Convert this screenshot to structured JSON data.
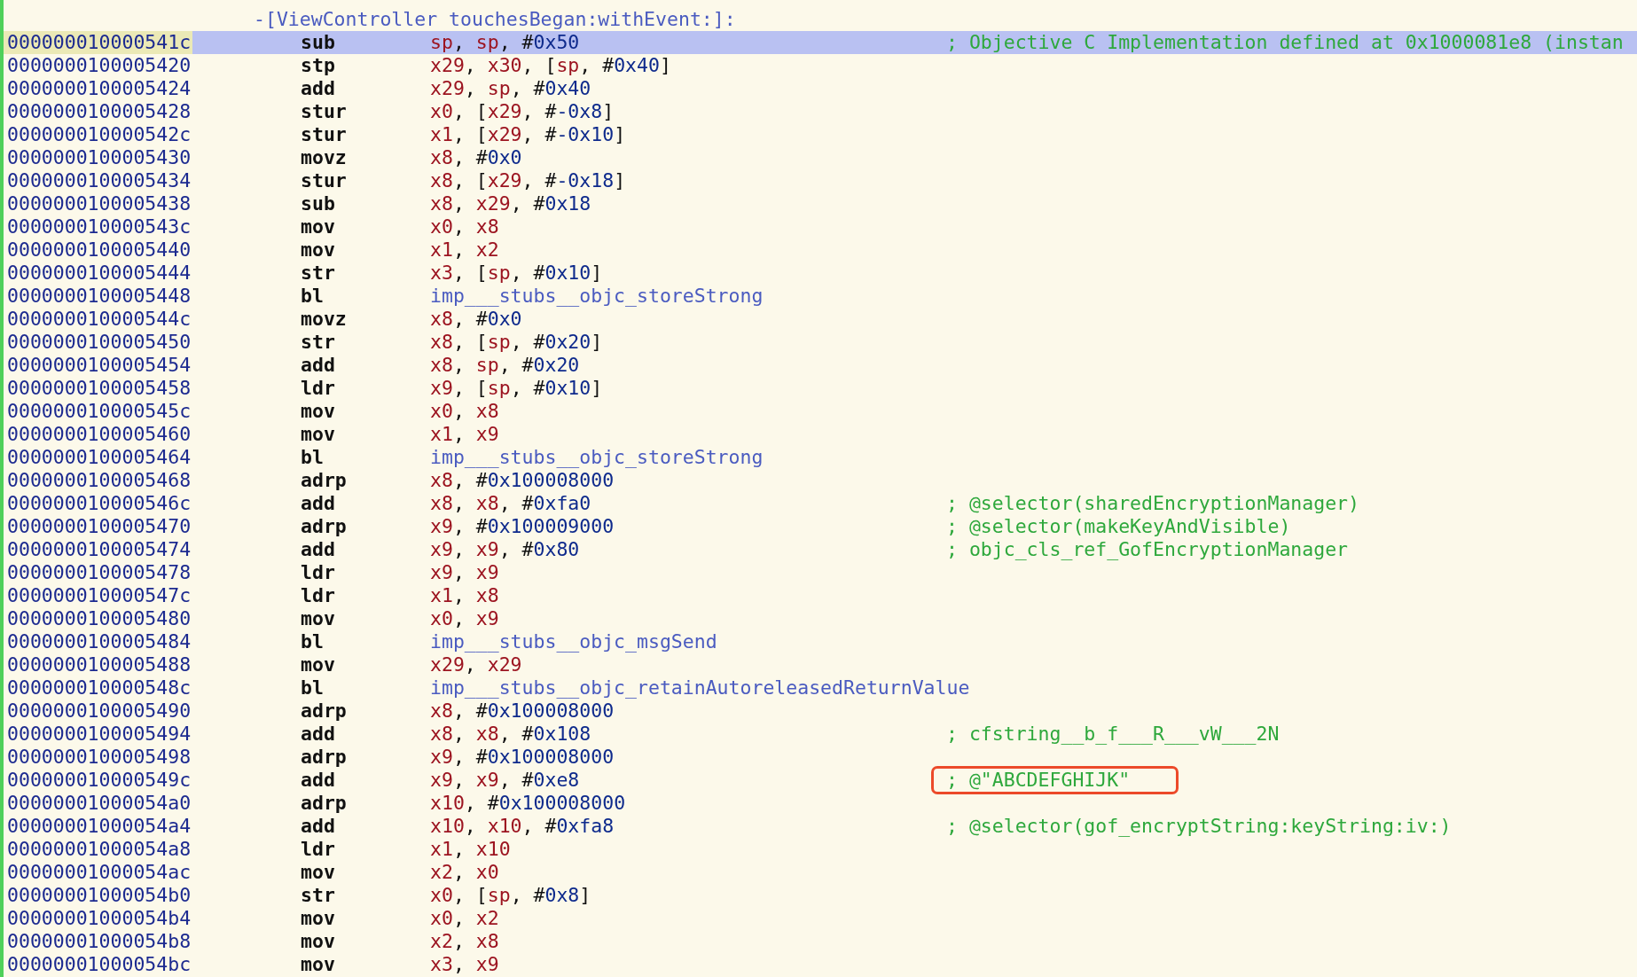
{
  "procedure_header": "-[ViewController touchesBegan:withEvent:]:",
  "rows": [
    {
      "address": "000000010000541c",
      "mnemonic": "sub",
      "operands": [
        {
          "kind": "reg",
          "text": "sp"
        },
        {
          "kind": "punct",
          "text": ", "
        },
        {
          "kind": "reg",
          "text": "sp"
        },
        {
          "kind": "punct",
          "text": ", #"
        },
        {
          "kind": "imm",
          "text": "0x50"
        }
      ],
      "comment": {
        "text": "; Objective C Implementation defined at 0x1000081e8 (instan",
        "boxed": false
      },
      "selected": true
    },
    {
      "address": "0000000100005420",
      "mnemonic": "stp",
      "operands": [
        {
          "kind": "reg",
          "text": "x29"
        },
        {
          "kind": "punct",
          "text": ", "
        },
        {
          "kind": "reg",
          "text": "x30"
        },
        {
          "kind": "punct",
          "text": ", ["
        },
        {
          "kind": "reg",
          "text": "sp"
        },
        {
          "kind": "punct",
          "text": ", #"
        },
        {
          "kind": "imm",
          "text": "0x40"
        },
        {
          "kind": "punct",
          "text": "]"
        }
      ],
      "selected": false
    },
    {
      "address": "0000000100005424",
      "mnemonic": "add",
      "operands": [
        {
          "kind": "reg",
          "text": "x29"
        },
        {
          "kind": "punct",
          "text": ", "
        },
        {
          "kind": "reg",
          "text": "sp"
        },
        {
          "kind": "punct",
          "text": ", #"
        },
        {
          "kind": "imm",
          "text": "0x40"
        }
      ],
      "selected": false
    },
    {
      "address": "0000000100005428",
      "mnemonic": "stur",
      "operands": [
        {
          "kind": "reg",
          "text": "x0"
        },
        {
          "kind": "punct",
          "text": ", ["
        },
        {
          "kind": "reg",
          "text": "x29"
        },
        {
          "kind": "punct",
          "text": ", #"
        },
        {
          "kind": "imm",
          "text": "-0x8"
        },
        {
          "kind": "punct",
          "text": "]"
        }
      ],
      "selected": false
    },
    {
      "address": "000000010000542c",
      "mnemonic": "stur",
      "operands": [
        {
          "kind": "reg",
          "text": "x1"
        },
        {
          "kind": "punct",
          "text": ", ["
        },
        {
          "kind": "reg",
          "text": "x29"
        },
        {
          "kind": "punct",
          "text": ", #"
        },
        {
          "kind": "imm",
          "text": "-0x10"
        },
        {
          "kind": "punct",
          "text": "]"
        }
      ],
      "selected": false
    },
    {
      "address": "0000000100005430",
      "mnemonic": "movz",
      "operands": [
        {
          "kind": "reg",
          "text": "x8"
        },
        {
          "kind": "punct",
          "text": ", #"
        },
        {
          "kind": "imm",
          "text": "0x0"
        }
      ],
      "selected": false
    },
    {
      "address": "0000000100005434",
      "mnemonic": "stur",
      "operands": [
        {
          "kind": "reg",
          "text": "x8"
        },
        {
          "kind": "punct",
          "text": ", ["
        },
        {
          "kind": "reg",
          "text": "x29"
        },
        {
          "kind": "punct",
          "text": ", #"
        },
        {
          "kind": "imm",
          "text": "-0x18"
        },
        {
          "kind": "punct",
          "text": "]"
        }
      ],
      "selected": false
    },
    {
      "address": "0000000100005438",
      "mnemonic": "sub",
      "operands": [
        {
          "kind": "reg",
          "text": "x8"
        },
        {
          "kind": "punct",
          "text": ", "
        },
        {
          "kind": "reg",
          "text": "x29"
        },
        {
          "kind": "punct",
          "text": ", #"
        },
        {
          "kind": "imm",
          "text": "0x18"
        }
      ],
      "selected": false
    },
    {
      "address": "000000010000543c",
      "mnemonic": "mov",
      "operands": [
        {
          "kind": "reg",
          "text": "x0"
        },
        {
          "kind": "punct",
          "text": ", "
        },
        {
          "kind": "reg",
          "text": "x8"
        }
      ],
      "selected": false
    },
    {
      "address": "0000000100005440",
      "mnemonic": "mov",
      "operands": [
        {
          "kind": "reg",
          "text": "x1"
        },
        {
          "kind": "punct",
          "text": ", "
        },
        {
          "kind": "reg",
          "text": "x2"
        }
      ],
      "selected": false
    },
    {
      "address": "0000000100005444",
      "mnemonic": "str",
      "operands": [
        {
          "kind": "reg",
          "text": "x3"
        },
        {
          "kind": "punct",
          "text": ", ["
        },
        {
          "kind": "reg",
          "text": "sp"
        },
        {
          "kind": "punct",
          "text": ", #"
        },
        {
          "kind": "imm",
          "text": "0x10"
        },
        {
          "kind": "punct",
          "text": "]"
        }
      ],
      "selected": false
    },
    {
      "address": "0000000100005448",
      "mnemonic": "bl",
      "operands": [
        {
          "kind": "sym",
          "text": "imp___stubs__objc_storeStrong"
        }
      ],
      "selected": false
    },
    {
      "address": "000000010000544c",
      "mnemonic": "movz",
      "operands": [
        {
          "kind": "reg",
          "text": "x8"
        },
        {
          "kind": "punct",
          "text": ", #"
        },
        {
          "kind": "imm",
          "text": "0x0"
        }
      ],
      "selected": false
    },
    {
      "address": "0000000100005450",
      "mnemonic": "str",
      "operands": [
        {
          "kind": "reg",
          "text": "x8"
        },
        {
          "kind": "punct",
          "text": ", ["
        },
        {
          "kind": "reg",
          "text": "sp"
        },
        {
          "kind": "punct",
          "text": ", #"
        },
        {
          "kind": "imm",
          "text": "0x20"
        },
        {
          "kind": "punct",
          "text": "]"
        }
      ],
      "selected": false
    },
    {
      "address": "0000000100005454",
      "mnemonic": "add",
      "operands": [
        {
          "kind": "reg",
          "text": "x8"
        },
        {
          "kind": "punct",
          "text": ", "
        },
        {
          "kind": "reg",
          "text": "sp"
        },
        {
          "kind": "punct",
          "text": ", #"
        },
        {
          "kind": "imm",
          "text": "0x20"
        }
      ],
      "selected": false
    },
    {
      "address": "0000000100005458",
      "mnemonic": "ldr",
      "operands": [
        {
          "kind": "reg",
          "text": "x9"
        },
        {
          "kind": "punct",
          "text": ", ["
        },
        {
          "kind": "reg",
          "text": "sp"
        },
        {
          "kind": "punct",
          "text": ", #"
        },
        {
          "kind": "imm",
          "text": "0x10"
        },
        {
          "kind": "punct",
          "text": "]"
        }
      ],
      "selected": false
    },
    {
      "address": "000000010000545c",
      "mnemonic": "mov",
      "operands": [
        {
          "kind": "reg",
          "text": "x0"
        },
        {
          "kind": "punct",
          "text": ", "
        },
        {
          "kind": "reg",
          "text": "x8"
        }
      ],
      "selected": false
    },
    {
      "address": "0000000100005460",
      "mnemonic": "mov",
      "operands": [
        {
          "kind": "reg",
          "text": "x1"
        },
        {
          "kind": "punct",
          "text": ", "
        },
        {
          "kind": "reg",
          "text": "x9"
        }
      ],
      "selected": false
    },
    {
      "address": "0000000100005464",
      "mnemonic": "bl",
      "operands": [
        {
          "kind": "sym",
          "text": "imp___stubs__objc_storeStrong"
        }
      ],
      "selected": false
    },
    {
      "address": "0000000100005468",
      "mnemonic": "adrp",
      "operands": [
        {
          "kind": "reg",
          "text": "x8"
        },
        {
          "kind": "punct",
          "text": ", #"
        },
        {
          "kind": "imm",
          "text": "0x100008000"
        }
      ],
      "selected": false
    },
    {
      "address": "000000010000546c",
      "mnemonic": "add",
      "operands": [
        {
          "kind": "reg",
          "text": "x8"
        },
        {
          "kind": "punct",
          "text": ", "
        },
        {
          "kind": "reg",
          "text": "x8"
        },
        {
          "kind": "punct",
          "text": ", #"
        },
        {
          "kind": "imm",
          "text": "0xfa0"
        }
      ],
      "comment": {
        "text": "; @selector(sharedEncryptionManager)",
        "boxed": false
      },
      "selected": false
    },
    {
      "address": "0000000100005470",
      "mnemonic": "adrp",
      "operands": [
        {
          "kind": "reg",
          "text": "x9"
        },
        {
          "kind": "punct",
          "text": ", #"
        },
        {
          "kind": "imm",
          "text": "0x100009000"
        }
      ],
      "comment": {
        "text": "; @selector(makeKeyAndVisible)",
        "boxed": false
      },
      "selected": false
    },
    {
      "address": "0000000100005474",
      "mnemonic": "add",
      "operands": [
        {
          "kind": "reg",
          "text": "x9"
        },
        {
          "kind": "punct",
          "text": ", "
        },
        {
          "kind": "reg",
          "text": "x9"
        },
        {
          "kind": "punct",
          "text": ", #"
        },
        {
          "kind": "imm",
          "text": "0x80"
        }
      ],
      "comment": {
        "text": "; objc_cls_ref_GofEncryptionManager",
        "boxed": false
      },
      "selected": false
    },
    {
      "address": "0000000100005478",
      "mnemonic": "ldr",
      "operands": [
        {
          "kind": "reg",
          "text": "x9"
        },
        {
          "kind": "punct",
          "text": ", "
        },
        {
          "kind": "reg",
          "text": "x9"
        }
      ],
      "selected": false
    },
    {
      "address": "000000010000547c",
      "mnemonic": "ldr",
      "operands": [
        {
          "kind": "reg",
          "text": "x1"
        },
        {
          "kind": "punct",
          "text": ", "
        },
        {
          "kind": "reg",
          "text": "x8"
        }
      ],
      "selected": false
    },
    {
      "address": "0000000100005480",
      "mnemonic": "mov",
      "operands": [
        {
          "kind": "reg",
          "text": "x0"
        },
        {
          "kind": "punct",
          "text": ", "
        },
        {
          "kind": "reg",
          "text": "x9"
        }
      ],
      "selected": false
    },
    {
      "address": "0000000100005484",
      "mnemonic": "bl",
      "operands": [
        {
          "kind": "sym",
          "text": "imp___stubs__objc_msgSend"
        }
      ],
      "selected": false
    },
    {
      "address": "0000000100005488",
      "mnemonic": "mov",
      "operands": [
        {
          "kind": "reg",
          "text": "x29"
        },
        {
          "kind": "punct",
          "text": ", "
        },
        {
          "kind": "reg",
          "text": "x29"
        }
      ],
      "selected": false
    },
    {
      "address": "000000010000548c",
      "mnemonic": "bl",
      "operands": [
        {
          "kind": "sym",
          "text": "imp___stubs__objc_retainAutoreleasedReturnValue"
        }
      ],
      "selected": false
    },
    {
      "address": "0000000100005490",
      "mnemonic": "adrp",
      "operands": [
        {
          "kind": "reg",
          "text": "x8"
        },
        {
          "kind": "punct",
          "text": ", #"
        },
        {
          "kind": "imm",
          "text": "0x100008000"
        }
      ],
      "selected": false
    },
    {
      "address": "0000000100005494",
      "mnemonic": "add",
      "operands": [
        {
          "kind": "reg",
          "text": "x8"
        },
        {
          "kind": "punct",
          "text": ", "
        },
        {
          "kind": "reg",
          "text": "x8"
        },
        {
          "kind": "punct",
          "text": ", #"
        },
        {
          "kind": "imm",
          "text": "0x108"
        }
      ],
      "comment": {
        "text": "; cfstring__b_f___R___vW___2N",
        "boxed": false
      },
      "selected": false
    },
    {
      "address": "0000000100005498",
      "mnemonic": "adrp",
      "operands": [
        {
          "kind": "reg",
          "text": "x9"
        },
        {
          "kind": "punct",
          "text": ", #"
        },
        {
          "kind": "imm",
          "text": "0x100008000"
        }
      ],
      "selected": false
    },
    {
      "address": "000000010000549c",
      "mnemonic": "add",
      "operands": [
        {
          "kind": "reg",
          "text": "x9"
        },
        {
          "kind": "punct",
          "text": ", "
        },
        {
          "kind": "reg",
          "text": "x9"
        },
        {
          "kind": "punct",
          "text": ", #"
        },
        {
          "kind": "imm",
          "text": "0xe8"
        }
      ],
      "comment": {
        "text": "; @\"ABCDEFGHIJK\"",
        "boxed": true
      },
      "selected": false
    },
    {
      "address": "00000001000054a0",
      "mnemonic": "adrp",
      "operands": [
        {
          "kind": "reg",
          "text": "x10"
        },
        {
          "kind": "punct",
          "text": ", #"
        },
        {
          "kind": "imm",
          "text": "0x100008000"
        }
      ],
      "selected": false
    },
    {
      "address": "00000001000054a4",
      "mnemonic": "add",
      "operands": [
        {
          "kind": "reg",
          "text": "x10"
        },
        {
          "kind": "punct",
          "text": ", "
        },
        {
          "kind": "reg",
          "text": "x10"
        },
        {
          "kind": "punct",
          "text": ", #"
        },
        {
          "kind": "imm",
          "text": "0xfa8"
        }
      ],
      "comment": {
        "text": "; @selector(gof_encryptString:keyString:iv:)",
        "boxed": false
      },
      "selected": false
    },
    {
      "address": "00000001000054a8",
      "mnemonic": "ldr",
      "operands": [
        {
          "kind": "reg",
          "text": "x1"
        },
        {
          "kind": "punct",
          "text": ", "
        },
        {
          "kind": "reg",
          "text": "x10"
        }
      ],
      "selected": false
    },
    {
      "address": "00000001000054ac",
      "mnemonic": "mov",
      "operands": [
        {
          "kind": "reg",
          "text": "x2"
        },
        {
          "kind": "punct",
          "text": ", "
        },
        {
          "kind": "reg",
          "text": "x0"
        }
      ],
      "selected": false
    },
    {
      "address": "00000001000054b0",
      "mnemonic": "str",
      "operands": [
        {
          "kind": "reg",
          "text": "x0"
        },
        {
          "kind": "punct",
          "text": ", ["
        },
        {
          "kind": "reg",
          "text": "sp"
        },
        {
          "kind": "punct",
          "text": ", #"
        },
        {
          "kind": "imm",
          "text": "0x8"
        },
        {
          "kind": "punct",
          "text": "]"
        }
      ],
      "selected": false
    },
    {
      "address": "00000001000054b4",
      "mnemonic": "mov",
      "operands": [
        {
          "kind": "reg",
          "text": "x0"
        },
        {
          "kind": "punct",
          "text": ", "
        },
        {
          "kind": "reg",
          "text": "x2"
        }
      ],
      "selected": false
    },
    {
      "address": "00000001000054b8",
      "mnemonic": "mov",
      "operands": [
        {
          "kind": "reg",
          "text": "x2"
        },
        {
          "kind": "punct",
          "text": ", "
        },
        {
          "kind": "reg",
          "text": "x8"
        }
      ],
      "selected": false
    },
    {
      "address": "00000001000054bc",
      "mnemonic": "mov",
      "operands": [
        {
          "kind": "reg",
          "text": "x3"
        },
        {
          "kind": "punct",
          "text": ", "
        },
        {
          "kind": "reg",
          "text": "x9"
        }
      ],
      "selected": false
    }
  ]
}
